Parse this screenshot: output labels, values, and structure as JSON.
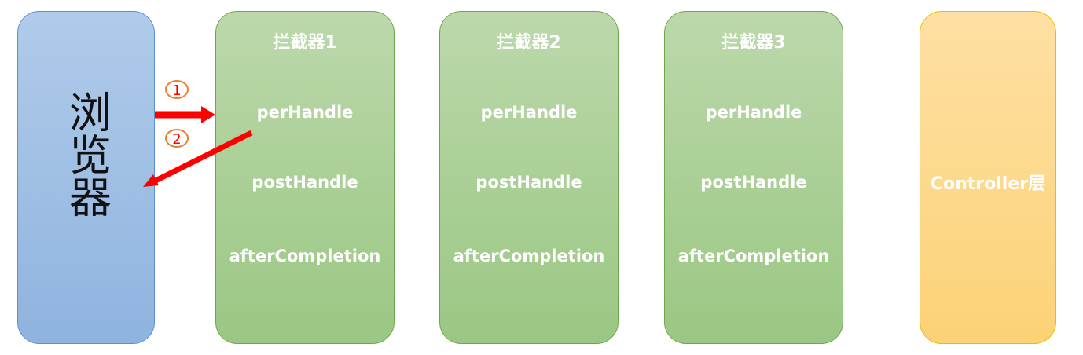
{
  "browser": {
    "label": "浏览器"
  },
  "interceptors": [
    {
      "title": "拦截器1",
      "methods": [
        "perHandle",
        "postHandle",
        "afterCompletion"
      ]
    },
    {
      "title": "拦截器2",
      "methods": [
        "perHandle",
        "postHandle",
        "afterCompletion"
      ]
    },
    {
      "title": "拦截器3",
      "methods": [
        "perHandle",
        "postHandle",
        "afterCompletion"
      ]
    }
  ],
  "controller": {
    "label": "Controller层"
  },
  "steps": [
    {
      "number": "1"
    },
    {
      "number": "2"
    }
  ],
  "colors": {
    "browser_fill": "#9dbde4",
    "browser_border": "#5b8fd4",
    "interceptor_fill": "#a9cf95",
    "interceptor_border": "#6fa84a",
    "controller_fill": "#fdd98a",
    "controller_border": "#f5b800",
    "arrow": "#ff0000",
    "step_circle": "#ed7d31"
  }
}
